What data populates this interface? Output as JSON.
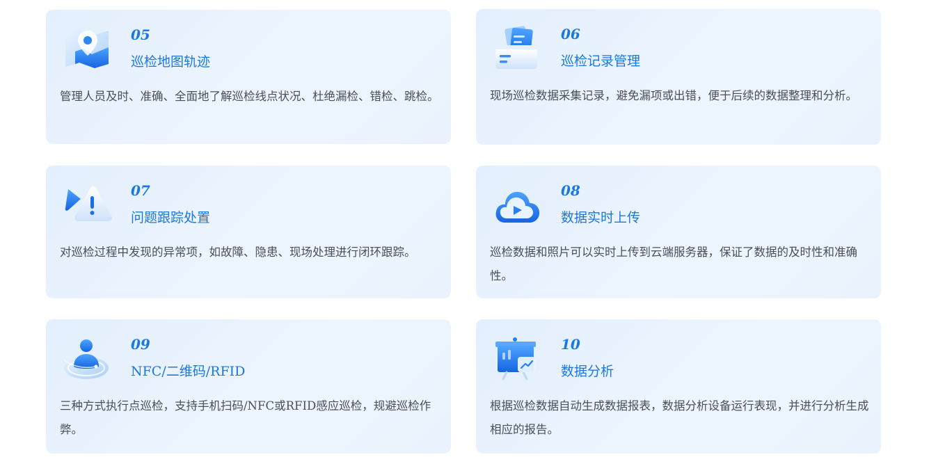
{
  "features": [
    {
      "number": "05",
      "title": "巡检地图轨迹",
      "description": "管理人员及时、准确、全面地了解巡检线点状况、杜绝漏检、错检、跳检。",
      "icon": "map-pin-icon"
    },
    {
      "number": "06",
      "title": "巡检记录管理",
      "description": "现场巡检数据采集记录，避免漏项或出错，便于后续的数据整理和分析。",
      "icon": "folder-records-icon"
    },
    {
      "number": "07",
      "title": "问题跟踪处置",
      "description": "对巡检过程中发现的异常项，如故障、隐患、现场处理进行闭环跟踪。",
      "icon": "warning-icon"
    },
    {
      "number": "08",
      "title": "数据实时上传",
      "description": "巡检数据和照片可以实时上传到云端服务器，保证了数据的及时性和准确性。",
      "icon": "cloud-upload-icon"
    },
    {
      "number": "09",
      "title": "NFC/二维码/RFID",
      "description": "三种方式执行点巡检，支持手机扫码/NFC或RFID感应巡检，规避巡检作弊。",
      "icon": "user-scan-icon"
    },
    {
      "number": "10",
      "title": "数据分析",
      "description": "根据巡检数据自动生成数据报表，数据分析设备运行表现，并进行分析生成相应的报告。",
      "icon": "chart-board-icon"
    }
  ]
}
